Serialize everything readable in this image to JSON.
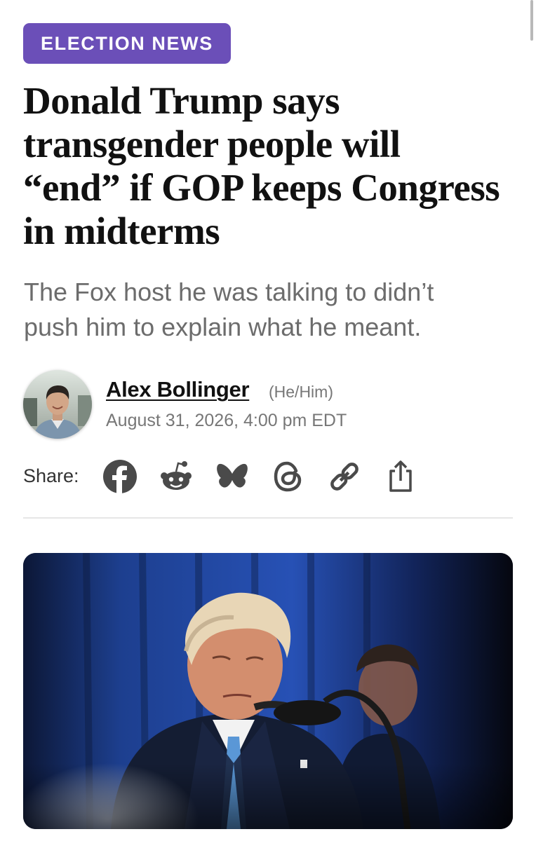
{
  "category": {
    "label": "ELECTION NEWS"
  },
  "article": {
    "headline_lines": [
      "Donald Trump says",
      "transgender people will",
      "“end” if GOP keeps Congress",
      "in midterms"
    ],
    "dek_lines": [
      "The Fox host he was talking to didn’t",
      "push him to explain what he meant."
    ]
  },
  "author": {
    "name": "Alex Bollinger",
    "pronouns": "(He/Him)",
    "published": "August 31, 2026, 4:00 pm EDT"
  },
  "share": {
    "label": "Share:",
    "icons": [
      "facebook-icon",
      "reddit-icon",
      "bluesky-icon",
      "threads-icon",
      "link-icon",
      "share-icon"
    ]
  },
  "colors": {
    "tag_background": "#6b4fb8",
    "icon_color": "#4a4a4a",
    "dek_color": "#6c6c6c"
  }
}
